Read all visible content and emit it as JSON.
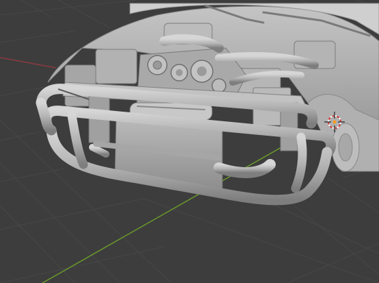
{
  "viewport": {
    "background": "#3d3d3d",
    "grid_color": "#474747",
    "x_axis_color": "#8a3b43",
    "y_axis_color": "#6a9a2a",
    "model_color": "#b8b8b8",
    "model_shadow_color": "#8c8c8c",
    "icons": [
      "3d-cursor-icon"
    ]
  }
}
